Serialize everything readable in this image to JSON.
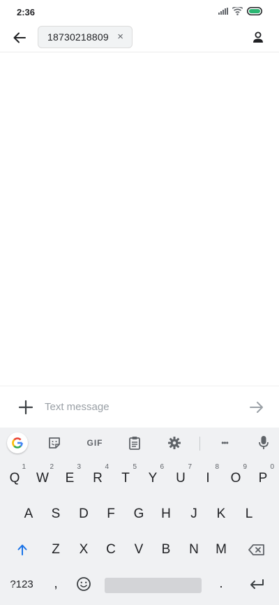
{
  "status": {
    "time": "2:36"
  },
  "header": {
    "recipient": "18730218809",
    "remove_symbol": "×"
  },
  "compose": {
    "placeholder": "Text message"
  },
  "keyboard": {
    "toolbar": {
      "gif_label": "GIF",
      "more_symbol": "•••"
    },
    "row1": [
      {
        "label": "Q",
        "hint": "1"
      },
      {
        "label": "W",
        "hint": "2"
      },
      {
        "label": "E",
        "hint": "3"
      },
      {
        "label": "R",
        "hint": "4"
      },
      {
        "label": "T",
        "hint": "5"
      },
      {
        "label": "Y",
        "hint": "6"
      },
      {
        "label": "U",
        "hint": "7"
      },
      {
        "label": "I",
        "hint": "8"
      },
      {
        "label": "O",
        "hint": "9"
      },
      {
        "label": "P",
        "hint": "0"
      }
    ],
    "row2": [
      "A",
      "S",
      "D",
      "F",
      "G",
      "H",
      "J",
      "K",
      "L"
    ],
    "row3": [
      "Z",
      "X",
      "C",
      "V",
      "B",
      "N",
      "M"
    ],
    "row4": {
      "symbols_label": "?123",
      "comma": ",",
      "period": "."
    }
  }
}
